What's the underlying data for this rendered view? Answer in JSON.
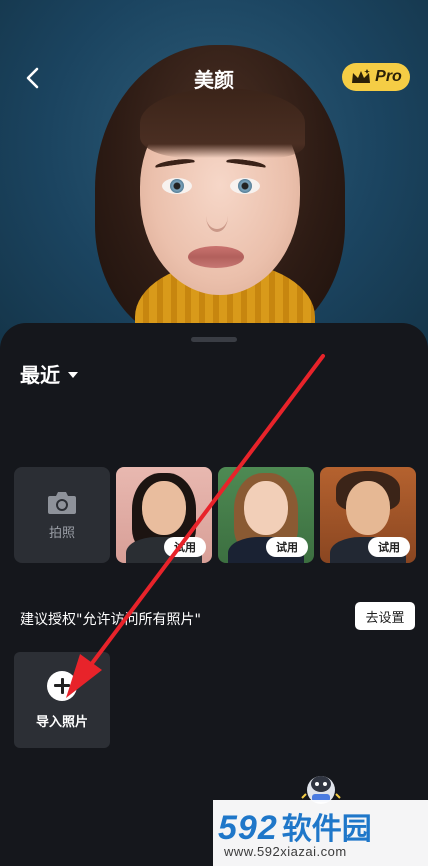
{
  "header": {
    "title": "美颜",
    "pro_label": "Pro"
  },
  "recent": {
    "label": "最近"
  },
  "camera": {
    "label": "拍照"
  },
  "samples": [
    {
      "badge": "试用"
    },
    {
      "badge": "试用"
    },
    {
      "badge": "试用"
    }
  ],
  "permission": {
    "text": "建议授权\"允许访问所有照片\"",
    "button": "去设置"
  },
  "import": {
    "label": "导入照片"
  },
  "watermark": {
    "brand_number": "592",
    "brand_text": "软件园",
    "url": "www.592xiazai.com"
  },
  "colors": {
    "pro_badge": "#f5cd45",
    "annotation_arrow": "#e8232a",
    "watermark": "#1f77c9"
  }
}
